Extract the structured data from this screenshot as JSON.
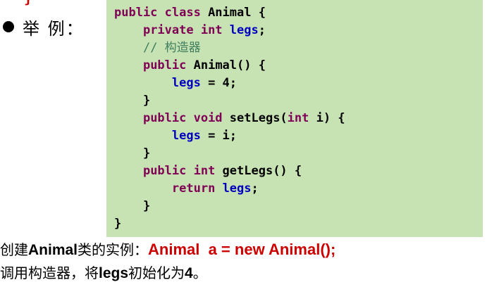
{
  "top_brace": "}",
  "bullet": {
    "label": "举 例："
  },
  "code": {
    "line1": {
      "kw": "public class",
      "rest": " Animal {"
    },
    "line2": {
      "indent": "    ",
      "kw": "private int",
      "sp": " ",
      "field": "legs",
      "rest": ";"
    },
    "line3": {
      "indent": "    ",
      "comment": "// 构造器"
    },
    "line4": {
      "indent": "    ",
      "kw": "public",
      "rest": " Animal() {"
    },
    "line5": {
      "indent": "        ",
      "field": "legs",
      "rest": " = 4;"
    },
    "line6": {
      "indent": "    ",
      "rest": "}"
    },
    "line7": {
      "indent": "    ",
      "kw1": "public void",
      "mid": " setLegs(",
      "kw2": "int",
      "rest": " i) {"
    },
    "line8": {
      "indent": "        ",
      "field": "legs",
      "rest": " = i;"
    },
    "line9": {
      "indent": "    ",
      "rest": "}"
    },
    "line10": {
      "indent": "    ",
      "kw": "public int",
      "rest": " getLegs() {"
    },
    "line11": {
      "indent": "        ",
      "kw": "return",
      "sp": " ",
      "field": "legs",
      "rest": ";"
    },
    "line12": {
      "indent": "    ",
      "rest": "}"
    },
    "line13": {
      "rest": "}"
    }
  },
  "bottom": {
    "line1_prefix": "创建",
    "line1_bold": "Animal",
    "line1_mid": "类的实例：",
    "line1_code": "Animal  a = new Animal();",
    "line2_prefix": "调用构造器，将",
    "line2_bold": "legs",
    "line2_mid": "初始化为",
    "line2_bold2": "4",
    "line2_end": "。"
  },
  "colors": {
    "code_background": "#c7e2b3",
    "keyword": "#7f0055",
    "field": "#0000c0",
    "comment": "#3f7f5f",
    "highlight_red": "#cc0000"
  }
}
